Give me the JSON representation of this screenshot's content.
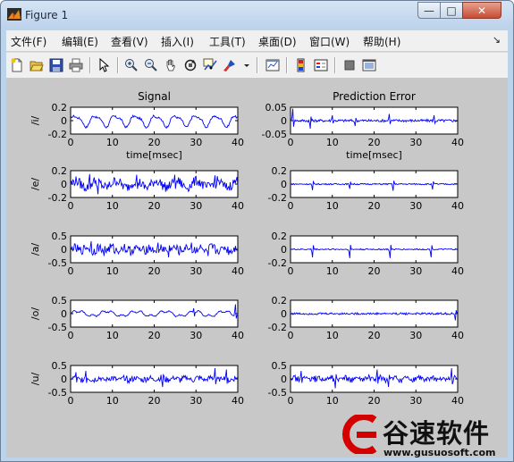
{
  "window": {
    "title": "Figure 1",
    "minimize_glyph": "—",
    "maximize_glyph": "□",
    "close_glyph": "✕"
  },
  "menubar": {
    "items": [
      "文件(F)",
      "编辑(E)",
      "查看(V)",
      "插入(I)",
      "工具(T)",
      "桌面(D)",
      "窗口(W)",
      "帮助(H)"
    ],
    "overflow": "↘"
  },
  "toolbar": {
    "icons": [
      "new-figure-icon",
      "open-file-icon",
      "save-icon",
      "print-icon",
      "select-arrow-icon",
      "zoom-in-icon",
      "zoom-out-icon",
      "pan-hand-icon",
      "rotate-3d-icon",
      "data-cursor-icon",
      "brush-icon",
      "brush-dropdown-icon",
      "link-plot-icon",
      "colorbar-icon",
      "legend-icon",
      "hide-plot-tools-icon",
      "show-plot-tools-icon"
    ]
  },
  "figure": {
    "background": "#c8c8c8",
    "line_color": "#0000ff",
    "column_titles": [
      "Signal",
      "Prediction Error"
    ],
    "row_labels": [
      "/i/",
      "/e/",
      "/a/",
      "/o/",
      "/u/"
    ],
    "xlabel": "time[msec]",
    "xticks": [
      "0",
      "10",
      "20",
      "30",
      "40"
    ],
    "yticks": [
      [
        [
          "0.2",
          "0",
          "-0.2"
        ],
        [
          "0.05",
          "0",
          "-0.05"
        ]
      ],
      [
        [
          "0.2",
          "0",
          "-0.2"
        ],
        [
          "0.2",
          "0",
          "-0.2"
        ]
      ],
      [
        [
          "0.5",
          "0",
          "-0.5"
        ],
        [
          "0.2",
          "0",
          "-0.2"
        ]
      ],
      [
        [
          "0.5",
          "0",
          "-0.5"
        ],
        [
          "0.2",
          "0",
          "-0.2"
        ]
      ],
      [
        [
          "0.5",
          "0",
          "-0.5"
        ],
        [
          "0.5",
          "0",
          "-0.5"
        ]
      ]
    ]
  },
  "chart_data": [
    {
      "type": "line",
      "panels": [
        {
          "row": "/i/",
          "column": "Signal",
          "xlim": [
            0,
            40
          ],
          "ylim": [
            -0.2,
            0.2
          ],
          "style": "periodic",
          "amplitude": 0.1,
          "period": 4.8,
          "spikes": []
        },
        {
          "row": "/i/",
          "column": "Prediction Error",
          "xlim": [
            0,
            40
          ],
          "ylim": [
            -0.05,
            0.05
          ],
          "style": "spiky",
          "amplitude": 0.005,
          "spikes": [
            [
              0.5,
              0.045
            ],
            [
              4.8,
              -0.03
            ],
            [
              10,
              0.02
            ],
            [
              15.5,
              -0.02
            ],
            [
              23.6,
              0.025
            ],
            [
              34.4,
              0.02
            ]
          ]
        },
        {
          "row": "/e/",
          "column": "Signal",
          "xlim": [
            0,
            40
          ],
          "ylim": [
            -0.2,
            0.2
          ],
          "style": "noisy",
          "amplitude": 0.12,
          "spikes": [
            [
              4.5,
              0.15
            ],
            [
              6.5,
              -0.15
            ],
            [
              15.8,
              0.14
            ],
            [
              25,
              0.14
            ],
            [
              34.5,
              0.13
            ]
          ]
        },
        {
          "row": "/e/",
          "column": "Prediction Error",
          "xlim": [
            0,
            40
          ],
          "ylim": [
            -0.2,
            0.2
          ],
          "style": "spiky",
          "amplitude": 0.01,
          "spikes": [
            [
              5.3,
              -0.09
            ],
            [
              14.2,
              -0.07
            ],
            [
              24.5,
              -0.1
            ],
            [
              34,
              -0.08
            ]
          ]
        },
        {
          "row": "/a/",
          "column": "Signal",
          "xlim": [
            0,
            40
          ],
          "ylim": [
            -0.5,
            0.5
          ],
          "style": "bursty",
          "amplitude": 0.3,
          "spikes": [
            [
              5,
              0.3
            ],
            [
              8,
              -0.25
            ],
            [
              13,
              0.2
            ],
            [
              21,
              0.25
            ],
            [
              23.5,
              -0.3
            ],
            [
              29,
              0.25
            ],
            [
              33,
              -0.25
            ]
          ]
        },
        {
          "row": "/a/",
          "column": "Prediction Error",
          "xlim": [
            0,
            40
          ],
          "ylim": [
            -0.2,
            0.2
          ],
          "style": "spiky",
          "amplitude": 0.01,
          "spikes": [
            [
              5.2,
              -0.12
            ],
            [
              14.2,
              -0.13
            ],
            [
              23.8,
              -0.13
            ],
            [
              33.6,
              -0.12
            ]
          ]
        },
        {
          "row": "/o/",
          "column": "Signal",
          "xlim": [
            0,
            40
          ],
          "ylim": [
            -0.5,
            0.5
          ],
          "style": "wavy",
          "amplitude": 0.15,
          "spikes": [
            [
              29.5,
              0.2
            ],
            [
              39.5,
              0.35
            ]
          ]
        },
        {
          "row": "/o/",
          "column": "Prediction Error",
          "xlim": [
            0,
            40
          ],
          "ylim": [
            -0.2,
            0.2
          ],
          "style": "spiky",
          "amplitude": 0.015,
          "spikes": [
            [
              39.5,
              -0.1
            ]
          ]
        },
        {
          "row": "/u/",
          "column": "Signal",
          "xlim": [
            0,
            40
          ],
          "ylim": [
            -0.5,
            0.5
          ],
          "style": "bursty",
          "amplitude": 0.2,
          "spikes": [
            [
              1.2,
              0.25
            ],
            [
              3.6,
              0.3
            ],
            [
              22,
              -0.3
            ],
            [
              34.5,
              0.4
            ],
            [
              37.2,
              0.35
            ]
          ]
        },
        {
          "row": "/u/",
          "column": "Prediction Error",
          "xlim": [
            0,
            40
          ],
          "ylim": [
            -0.5,
            0.5
          ],
          "style": "bursty",
          "amplitude": 0.2,
          "spikes": [
            [
              2.5,
              0.3
            ],
            [
              10.8,
              -0.35
            ],
            [
              20.8,
              0.35
            ],
            [
              23.5,
              -0.3
            ],
            [
              38.5,
              0.4
            ]
          ]
        }
      ]
    }
  ],
  "watermark": {
    "brand_text": "谷速软件",
    "url": "www.gusuosoft.com",
    "accent_color": "#d40000"
  }
}
